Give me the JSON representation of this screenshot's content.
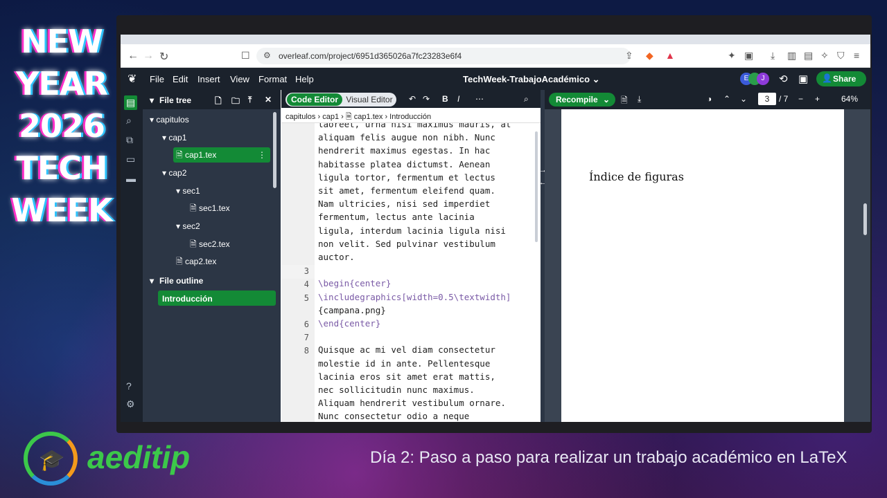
{
  "overlay": {
    "headline": [
      "NEW",
      "YEAR",
      "2026",
      "TECH",
      "WEEK"
    ],
    "brand": "aeditip",
    "caption": "Día 2: Paso a paso para realizar un trabajo académico en LaTeX"
  },
  "browser": {
    "url": "overleaf.com/project/6951d365026a7fc23283e6f4"
  },
  "toolbar": {
    "menu": [
      "File",
      "Edit",
      "Insert",
      "View",
      "Format",
      "Help"
    ],
    "project_title": "TechWeek-TrabajoAcadémico ⌄",
    "avatars": [
      "E",
      "",
      "J"
    ],
    "share_label": "Share"
  },
  "file_tree": {
    "header": "File tree",
    "items": [
      {
        "label": "capitulos",
        "depth": 0,
        "type": "folder"
      },
      {
        "label": "cap1",
        "depth": 1,
        "type": "folder"
      },
      {
        "label": "cap1.tex",
        "depth": 2,
        "type": "file",
        "selected": true
      },
      {
        "label": "cap2",
        "depth": 1,
        "type": "folder"
      },
      {
        "label": "sec1",
        "depth": 2,
        "type": "folder"
      },
      {
        "label": "sec1.tex",
        "depth": 3,
        "type": "file"
      },
      {
        "label": "sec2",
        "depth": 2,
        "type": "folder"
      },
      {
        "label": "sec2.tex",
        "depth": 3,
        "type": "file"
      },
      {
        "label": "cap2.tex",
        "depth": 1,
        "type": "file"
      }
    ],
    "outline_header": "File outline",
    "outline_selected": "Introducción"
  },
  "editor": {
    "code_editor_label": "Code Editor",
    "visual_editor_label": "Visual Editor",
    "breadcrumb": [
      "capitulos",
      "cap1",
      "cap1.tex",
      "Introducción"
    ],
    "lines": [
      {
        "num": "",
        "text": "laoreet, urna nisi maximus mauris, at"
      },
      {
        "num": "",
        "text": "aliquam felis augue non nibh. Nunc"
      },
      {
        "num": "",
        "text": "hendrerit maximus egestas. In hac"
      },
      {
        "num": "",
        "text": "habitasse platea dictumst. Aenean"
      },
      {
        "num": "",
        "text": "ligula tortor, fermentum et lectus"
      },
      {
        "num": "",
        "text": "sit amet, fermentum eleifend quam."
      },
      {
        "num": "",
        "text": "Nam ultricies, nisi sed imperdiet"
      },
      {
        "num": "",
        "text": "fermentum, lectus ante lacinia"
      },
      {
        "num": "",
        "text": "ligula, interdum lacinia ligula nisi"
      },
      {
        "num": "",
        "text": "non velit. Sed pulvinar vestibulum"
      },
      {
        "num": "",
        "text": "auctor."
      },
      {
        "num": "3",
        "text": ""
      },
      {
        "num": "4",
        "text": "\\begin{center}"
      },
      {
        "num": "5",
        "text": "\\includegraphics[width=0.5\\textwidth]"
      },
      {
        "num": "",
        "text": "{campana.png}"
      },
      {
        "num": "6",
        "text": "\\end{center}"
      },
      {
        "num": "7",
        "text": ""
      },
      {
        "num": "8",
        "text": "Quisque ac mi vel diam consectetur"
      },
      {
        "num": "",
        "text": "molestie id in ante. Pellentesque"
      },
      {
        "num": "",
        "text": "lacinia eros sit amet erat mattis,"
      },
      {
        "num": "",
        "text": "nec sollicitudin nunc maximus."
      },
      {
        "num": "",
        "text": "Aliquam hendrerit vestibulum ornare."
      },
      {
        "num": "",
        "text": "Nunc consectetur odio a neque"
      }
    ]
  },
  "pdf": {
    "recompile_label": "Recompile",
    "page_current": "3",
    "page_total": "/ 7",
    "zoom": "64%",
    "page_heading": "Índice de figuras"
  }
}
